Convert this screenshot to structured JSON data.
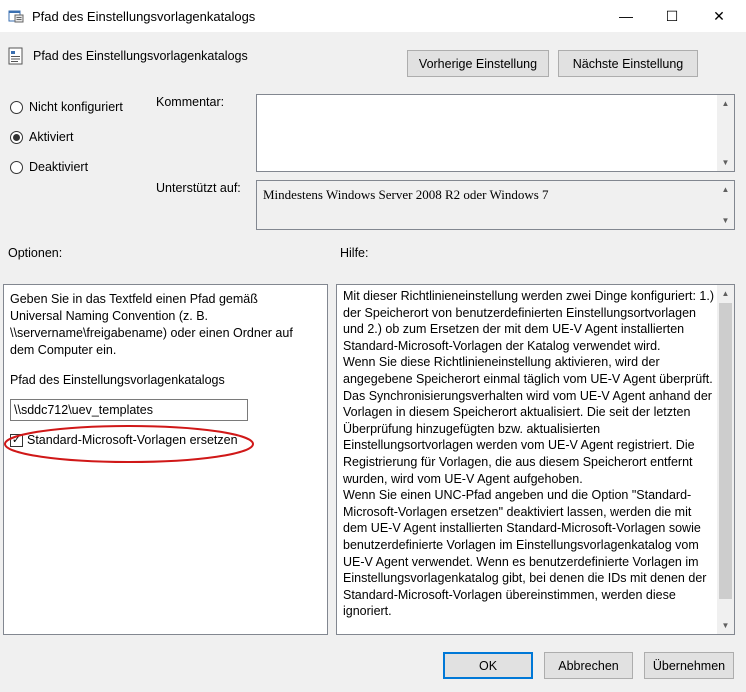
{
  "window": {
    "title": "Pfad des Einstellungsvorlagenkatalogs",
    "minimize_glyph": "—",
    "maximize_glyph": "☐",
    "close_glyph": "✕"
  },
  "header": {
    "policy_title": "Pfad des Einstellungsvorlagenkatalogs",
    "prev_button": "Vorherige Einstellung",
    "next_button": "Nächste Einstellung"
  },
  "state": {
    "options": [
      {
        "label": "Nicht konfiguriert",
        "selected": false
      },
      {
        "label": "Aktiviert",
        "selected": true
      },
      {
        "label": "Deaktiviert",
        "selected": false
      }
    ]
  },
  "comment": {
    "label": "Kommentar:",
    "value": ""
  },
  "supported": {
    "label": "Unterstützt auf:",
    "value": "Mindestens Windows Server 2008 R2 oder Windows 7"
  },
  "options_panel": {
    "header": "Optionen:",
    "description": "Geben Sie in das Textfeld einen Pfad gemäß Universal Naming Convention (z. B. \\\\servername\\freigabename) oder einen Ordner auf dem Computer ein.",
    "path_label": "Pfad des Einstellungsvorlagenkatalogs",
    "path_value": "\\\\sddc712\\uev_templates",
    "checkbox_label": "Standard-Microsoft-Vorlagen ersetzen",
    "checkbox_checked": true,
    "check_glyph": "✓",
    "highlight_color": "#d01818"
  },
  "help_panel": {
    "header": "Hilfe:",
    "text": "Mit dieser Richtlinieneinstellung werden zwei Dinge konfiguriert: 1.) der Speicherort von benutzerdefinierten Einstellungsortvorlagen und 2.) ob zum Ersetzen der mit dem UE-V Agent installierten Standard-Microsoft-Vorlagen der Katalog verwendet wird.\nWenn Sie diese Richtlinieneinstellung aktivieren, wird der angegebene Speicherort einmal täglich vom UE-V Agent überprüft. Das Synchronisierungsverhalten wird vom UE-V Agent anhand der Vorlagen in diesem Speicherort aktualisiert. Die seit der letzten Überprüfung hinzugefügten bzw. aktualisierten Einstellungsortvorlagen werden vom UE-V Agent registriert. Die Registrierung für Vorlagen, die aus diesem Speicherort entfernt wurden, wird vom UE-V Agent aufgehoben.\nWenn Sie einen UNC-Pfad angeben und die Option \"Standard-Microsoft-Vorlagen ersetzen\" deaktiviert lassen, werden die mit dem UE-V Agent installierten Standard-Microsoft-Vorlagen sowie benutzerdefinierte Vorlagen im Einstellungsvorlagenkatalog vom UE-V Agent verwendet. Wenn es benutzerdefinierte Vorlagen im Einstellungsvorlagenkatalog gibt, bei denen die IDs mit denen der Standard-Microsoft-Vorlagen übereinstimmen, werden diese ignoriert."
  },
  "footer": {
    "ok": "OK",
    "cancel": "Abbrechen",
    "apply": "Übernehmen"
  },
  "scroll_arrows": {
    "up": "▲",
    "down": "▼"
  }
}
